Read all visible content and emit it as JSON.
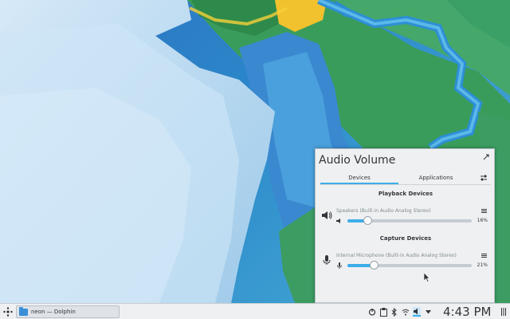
{
  "popup": {
    "title": "Audio Volume",
    "tabs": [
      {
        "label": "Devices",
        "active": true
      },
      {
        "label": "Applications",
        "active": false
      }
    ],
    "playback": {
      "section_title": "Playback Devices",
      "device_name": "Speakers (Built-in Audio Analog Stereo)",
      "volume_percent": 16,
      "volume_text": "16%"
    },
    "capture": {
      "section_title": "Capture Devices",
      "device_name": "Internal Microphone (Built-in Audio Analog Stereo)",
      "volume_percent": 21,
      "volume_text": "21%"
    }
  },
  "taskbar": {
    "task_label": "neon — Dolphin",
    "clock": "4:43 PM",
    "tray_icons": [
      "power-icon",
      "clipboard-icon",
      "bluetooth-icon",
      "wifi-icon",
      "volume-icon",
      "expand-tray-icon"
    ]
  },
  "colors": {
    "accent": "#3daee9",
    "panel_bg": "#eff0f1",
    "text": "#31363b"
  }
}
